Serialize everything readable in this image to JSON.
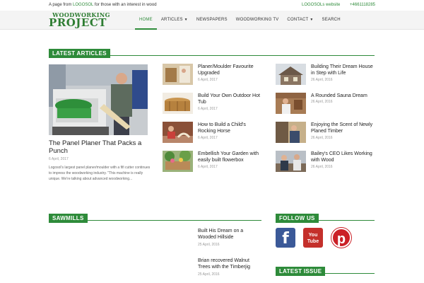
{
  "topbar": {
    "tagline_prefix": "A page from ",
    "tagline_brand": "LOGOSOL",
    "tagline_suffix": " for those with an interest in wood",
    "website_link": "LOGOSOLs website",
    "phone": "+4661118285"
  },
  "logo": {
    "line1": "WOODWORKING",
    "line2": "PROJECT"
  },
  "nav": [
    {
      "label": "HOME",
      "active": true
    },
    {
      "label": "ARTICLES",
      "dropdown": true
    },
    {
      "label": "NEWSPAPERS"
    },
    {
      "label": "WOODWORKING TV"
    },
    {
      "label": "CONTACT",
      "dropdown": true
    },
    {
      "label": "SEARCH"
    }
  ],
  "latest": {
    "title": "LATEST ARTICLES",
    "featured": {
      "title": "The Panel Planer That Packs a Punch",
      "date": "6 April, 2017",
      "excerpt": "Logosol's largest panel planer/moulder with a fifi cutter continues to impress the woodworking industry. \"This machine is really unique. We're talking about advanced woodworking..."
    },
    "col2": [
      {
        "title": "Planer/Moulder Favourite Upgraded",
        "date": "6 April, 2017"
      },
      {
        "title": "Build Your Own Outdoor Hot Tub",
        "date": "6 April, 2017"
      },
      {
        "title": "How to Build a Child's Rocking Horse",
        "date": "6 April, 2017"
      },
      {
        "title": "Embellish Your Garden with easily built flowerbox",
        "date": "6 April, 2017"
      }
    ],
    "col3": [
      {
        "title": "Building Their Dream House in Step with Life",
        "date": "26 April, 2016"
      },
      {
        "title": "A Rounded Sauna Dream",
        "date": "26 April, 2016"
      },
      {
        "title": "Enjoying the Scent of Newly Planed Timber",
        "date": "26 April, 2016"
      },
      {
        "title": "Bailey's CEO Likes Working with Wood",
        "date": "26 April, 2016"
      }
    ]
  },
  "sawmills": {
    "title": "SAWMILLS",
    "items": [
      {
        "title": "Built His Dream on a Wooded Hillside",
        "date": "25 April, 2016"
      },
      {
        "title": "Brian recovered Walnut Trees with the Timberjig",
        "date": "25 April, 2016"
      }
    ]
  },
  "follow": {
    "title": "FOLLOW US",
    "facebook": "f",
    "youtube_1": "You",
    "youtube_2": "Tube",
    "pinterest": "p"
  },
  "latest_issue": {
    "title": "LATEST ISSUE"
  },
  "colors": {
    "accent": "#2e8b3a",
    "facebook": "#3b5998",
    "youtube": "#c4302b",
    "pinterest": "#cb2027"
  }
}
